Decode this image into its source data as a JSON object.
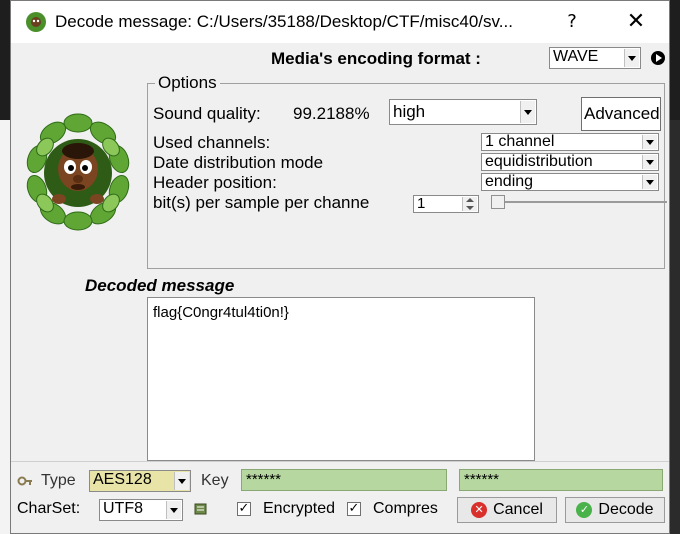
{
  "window": {
    "title": "Decode message: C:/Users/35188/Desktop/CTF/misc40/sv...",
    "help_label": "?",
    "close_label": "✕"
  },
  "media": {
    "label": "Media's encoding format :",
    "format": "WAVE"
  },
  "options": {
    "title": "Options",
    "sound_quality_label": "Sound quality:",
    "sound_quality_value": "99.2188%",
    "quality_select": "high",
    "advanced_label": "Advanced",
    "used_channels_label": "Used channels:",
    "used_channels_value": "1 channel",
    "distribution_label": "Date distribution mode",
    "distribution_value": "equidistribution",
    "header_label": "Header position:",
    "header_value": "ending",
    "bits_label": "bit(s) per sample per channe",
    "bits_value": "1"
  },
  "decoded": {
    "title": "Decoded message",
    "message": "flag{C0ngr4tul4ti0n!}"
  },
  "crypto": {
    "type_label": "Type",
    "type_value": "AES128",
    "key_label": "Key",
    "key_value": "******",
    "key_confirm_value": "******"
  },
  "footer": {
    "charset_label": "CharSet:",
    "charset_value": "UTF8",
    "encrypted_label": "Encrypted",
    "compressed_label": "Compres",
    "cancel_label": "Cancel",
    "decode_label": "Decode"
  },
  "colors": {
    "key_field": "#b6d7a0",
    "type_field": "#e8e4a8"
  }
}
